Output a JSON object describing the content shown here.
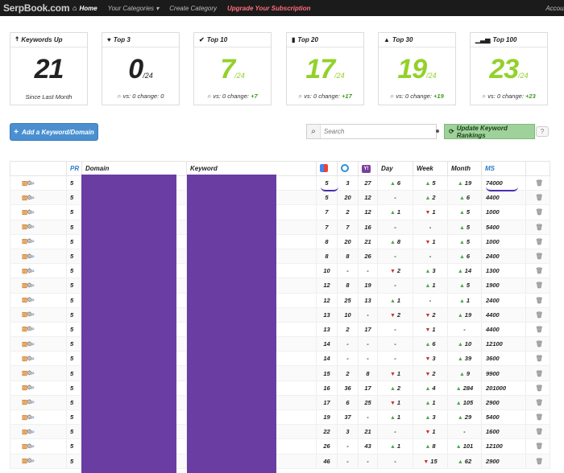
{
  "nav": {
    "brand": "SerpBook.com",
    "home": "Home",
    "categories": "Your Categories ▾",
    "create_category": "Create Category",
    "upgrade": "Upgrade Your Subscription",
    "account": "Accoun"
  },
  "cards": [
    {
      "title": "Keywords Up",
      "icon": "arrow-up-icon",
      "value": "21",
      "denominator": "",
      "footer": "Since Last Month",
      "change": ""
    },
    {
      "title": "Top 3",
      "icon": "heart-icon",
      "value": "0",
      "denominator": "/24",
      "footer": "vs: 0 change: 0",
      "change": ""
    },
    {
      "title": "Top 10",
      "icon": "check-icon",
      "value": "7",
      "denominator": "/24",
      "footer": "vs: 0 change:",
      "change": "+7"
    },
    {
      "title": "Top 20",
      "icon": "bookmark-icon",
      "value": "17",
      "denominator": "/24",
      "footer": "vs: 0 change:",
      "change": "+17"
    },
    {
      "title": "Top 30",
      "icon": "road-icon",
      "value": "19",
      "denominator": "/24",
      "footer": "vs: 0 change:",
      "change": "+19"
    },
    {
      "title": "Top 100",
      "icon": "signal-icon",
      "value": "23",
      "denominator": "/24",
      "footer": "vs: 0 change:",
      "change": "+23"
    }
  ],
  "toolbar": {
    "add_label": "Add a Keyword/Domain",
    "search_placeholder": "Search",
    "update_label": "Update Keyword Rankings"
  },
  "table": {
    "headers": {
      "pr": "PR",
      "domain": "Domain",
      "keyword": "Keyword",
      "day": "Day",
      "week": "Week",
      "month": "Month",
      "ms": "MS"
    },
    "rows": [
      {
        "pr": "5",
        "g": "5",
        "b": "3",
        "y": "27",
        "day": {
          "dir": "up",
          "v": "6"
        },
        "week": {
          "dir": "up",
          "v": "5"
        },
        "month": {
          "dir": "up",
          "v": "19"
        },
        "ms": "74000"
      },
      {
        "pr": "5",
        "g": "5",
        "b": "20",
        "y": "12",
        "day": {
          "dir": "",
          "v": "-"
        },
        "week": {
          "dir": "up",
          "v": "2"
        },
        "month": {
          "dir": "up",
          "v": "6"
        },
        "ms": "4400"
      },
      {
        "pr": "5",
        "g": "7",
        "b": "2",
        "y": "12",
        "day": {
          "dir": "up",
          "v": "1"
        },
        "week": {
          "dir": "down",
          "v": "1"
        },
        "month": {
          "dir": "up",
          "v": "5"
        },
        "ms": "1000"
      },
      {
        "pr": "5",
        "g": "7",
        "b": "7",
        "y": "16",
        "day": {
          "dir": "",
          "v": "-"
        },
        "week": {
          "dir": "",
          "v": "-"
        },
        "month": {
          "dir": "up",
          "v": "5"
        },
        "ms": "5400"
      },
      {
        "pr": "5",
        "g": "8",
        "b": "20",
        "y": "21",
        "day": {
          "dir": "up",
          "v": "8"
        },
        "week": {
          "dir": "down",
          "v": "1"
        },
        "month": {
          "dir": "up",
          "v": "5"
        },
        "ms": "1000"
      },
      {
        "pr": "5",
        "g": "8",
        "b": "8",
        "y": "26",
        "day": {
          "dir": "",
          "v": "-"
        },
        "week": {
          "dir": "",
          "v": "-"
        },
        "month": {
          "dir": "up",
          "v": "6"
        },
        "ms": "2400"
      },
      {
        "pr": "5",
        "g": "10",
        "b": "-",
        "y": "-",
        "day": {
          "dir": "down",
          "v": "2"
        },
        "week": {
          "dir": "up",
          "v": "3"
        },
        "month": {
          "dir": "up",
          "v": "14"
        },
        "ms": "1300"
      },
      {
        "pr": "5",
        "g": "12",
        "b": "8",
        "y": "19",
        "day": {
          "dir": "",
          "v": "-"
        },
        "week": {
          "dir": "up",
          "v": "1"
        },
        "month": {
          "dir": "up",
          "v": "5"
        },
        "ms": "1900"
      },
      {
        "pr": "5",
        "g": "12",
        "b": "25",
        "y": "13",
        "day": {
          "dir": "up",
          "v": "1"
        },
        "week": {
          "dir": "",
          "v": "-"
        },
        "month": {
          "dir": "up",
          "v": "1"
        },
        "ms": "2400"
      },
      {
        "pr": "5",
        "g": "13",
        "b": "10",
        "y": "-",
        "day": {
          "dir": "down",
          "v": "2"
        },
        "week": {
          "dir": "down",
          "v": "2"
        },
        "month": {
          "dir": "up",
          "v": "19"
        },
        "ms": "4400"
      },
      {
        "pr": "5",
        "g": "13",
        "b": "2",
        "y": "17",
        "day": {
          "dir": "",
          "v": "-"
        },
        "week": {
          "dir": "down",
          "v": "1"
        },
        "month": {
          "dir": "",
          "v": "-"
        },
        "ms": "4400"
      },
      {
        "pr": "5",
        "g": "14",
        "b": "-",
        "y": "-",
        "day": {
          "dir": "",
          "v": "-"
        },
        "week": {
          "dir": "up",
          "v": "6"
        },
        "month": {
          "dir": "up",
          "v": "10"
        },
        "ms": "12100"
      },
      {
        "pr": "5",
        "g": "14",
        "b": "-",
        "y": "-",
        "day": {
          "dir": "",
          "v": "-"
        },
        "week": {
          "dir": "down",
          "v": "3"
        },
        "month": {
          "dir": "up",
          "v": "39"
        },
        "ms": "3600"
      },
      {
        "pr": "5",
        "g": "15",
        "b": "2",
        "y": "8",
        "day": {
          "dir": "down",
          "v": "1"
        },
        "week": {
          "dir": "down",
          "v": "2"
        },
        "month": {
          "dir": "up",
          "v": "9"
        },
        "ms": "9900"
      },
      {
        "pr": "5",
        "g": "16",
        "b": "36",
        "y": "17",
        "day": {
          "dir": "up",
          "v": "2"
        },
        "week": {
          "dir": "up",
          "v": "4"
        },
        "month": {
          "dir": "up",
          "v": "284"
        },
        "ms": "201000"
      },
      {
        "pr": "5",
        "g": "17",
        "b": "6",
        "y": "25",
        "day": {
          "dir": "down",
          "v": "1"
        },
        "week": {
          "dir": "up",
          "v": "1"
        },
        "month": {
          "dir": "up",
          "v": "105"
        },
        "ms": "2900"
      },
      {
        "pr": "5",
        "g": "19",
        "b": "37",
        "y": "-",
        "day": {
          "dir": "up",
          "v": "1"
        },
        "week": {
          "dir": "up",
          "v": "3"
        },
        "month": {
          "dir": "up",
          "v": "29"
        },
        "ms": "5400"
      },
      {
        "pr": "5",
        "g": "22",
        "b": "3",
        "y": "21",
        "day": {
          "dir": "",
          "v": "-"
        },
        "week": {
          "dir": "down",
          "v": "1"
        },
        "month": {
          "dir": "",
          "v": "-"
        },
        "ms": "1600"
      },
      {
        "pr": "5",
        "g": "26",
        "b": "-",
        "y": "43",
        "day": {
          "dir": "up",
          "v": "1"
        },
        "week": {
          "dir": "up",
          "v": "8"
        },
        "month": {
          "dir": "up",
          "v": "101"
        },
        "ms": "12100"
      },
      {
        "pr": "5",
        "g": "46",
        "b": "-",
        "y": "-",
        "day": {
          "dir": "",
          "v": "-"
        },
        "week": {
          "dir": "down",
          "v": "15"
        },
        "month": {
          "dir": "up",
          "v": "62"
        },
        "ms": "2900"
      }
    ]
  },
  "colors": {
    "accent_blue": "#4a90d0",
    "card_green": "#93d12a",
    "redaction_purple": "#6a3da3",
    "update_green": "#9fd29a"
  }
}
